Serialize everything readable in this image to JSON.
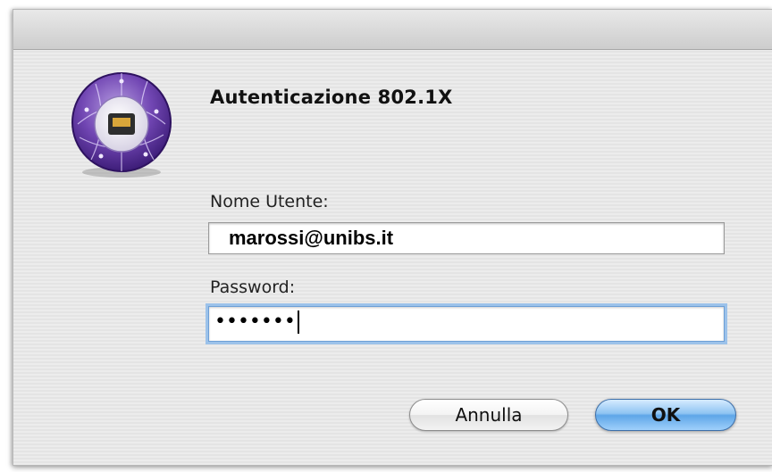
{
  "dialog": {
    "heading": "Autenticazione 802.1X",
    "icon": "network-globe-icon",
    "username_label": "Nome Utente:",
    "username_value": "marossi@unibs.it",
    "password_label": "Password:",
    "password_value": "•••••••",
    "cancel_label": "Annulla",
    "ok_label": "OK"
  },
  "colors": {
    "icon_purple": "#6a3fa0",
    "ok_button": "#5ea6e8",
    "focus_ring": "#9cc2ea"
  }
}
